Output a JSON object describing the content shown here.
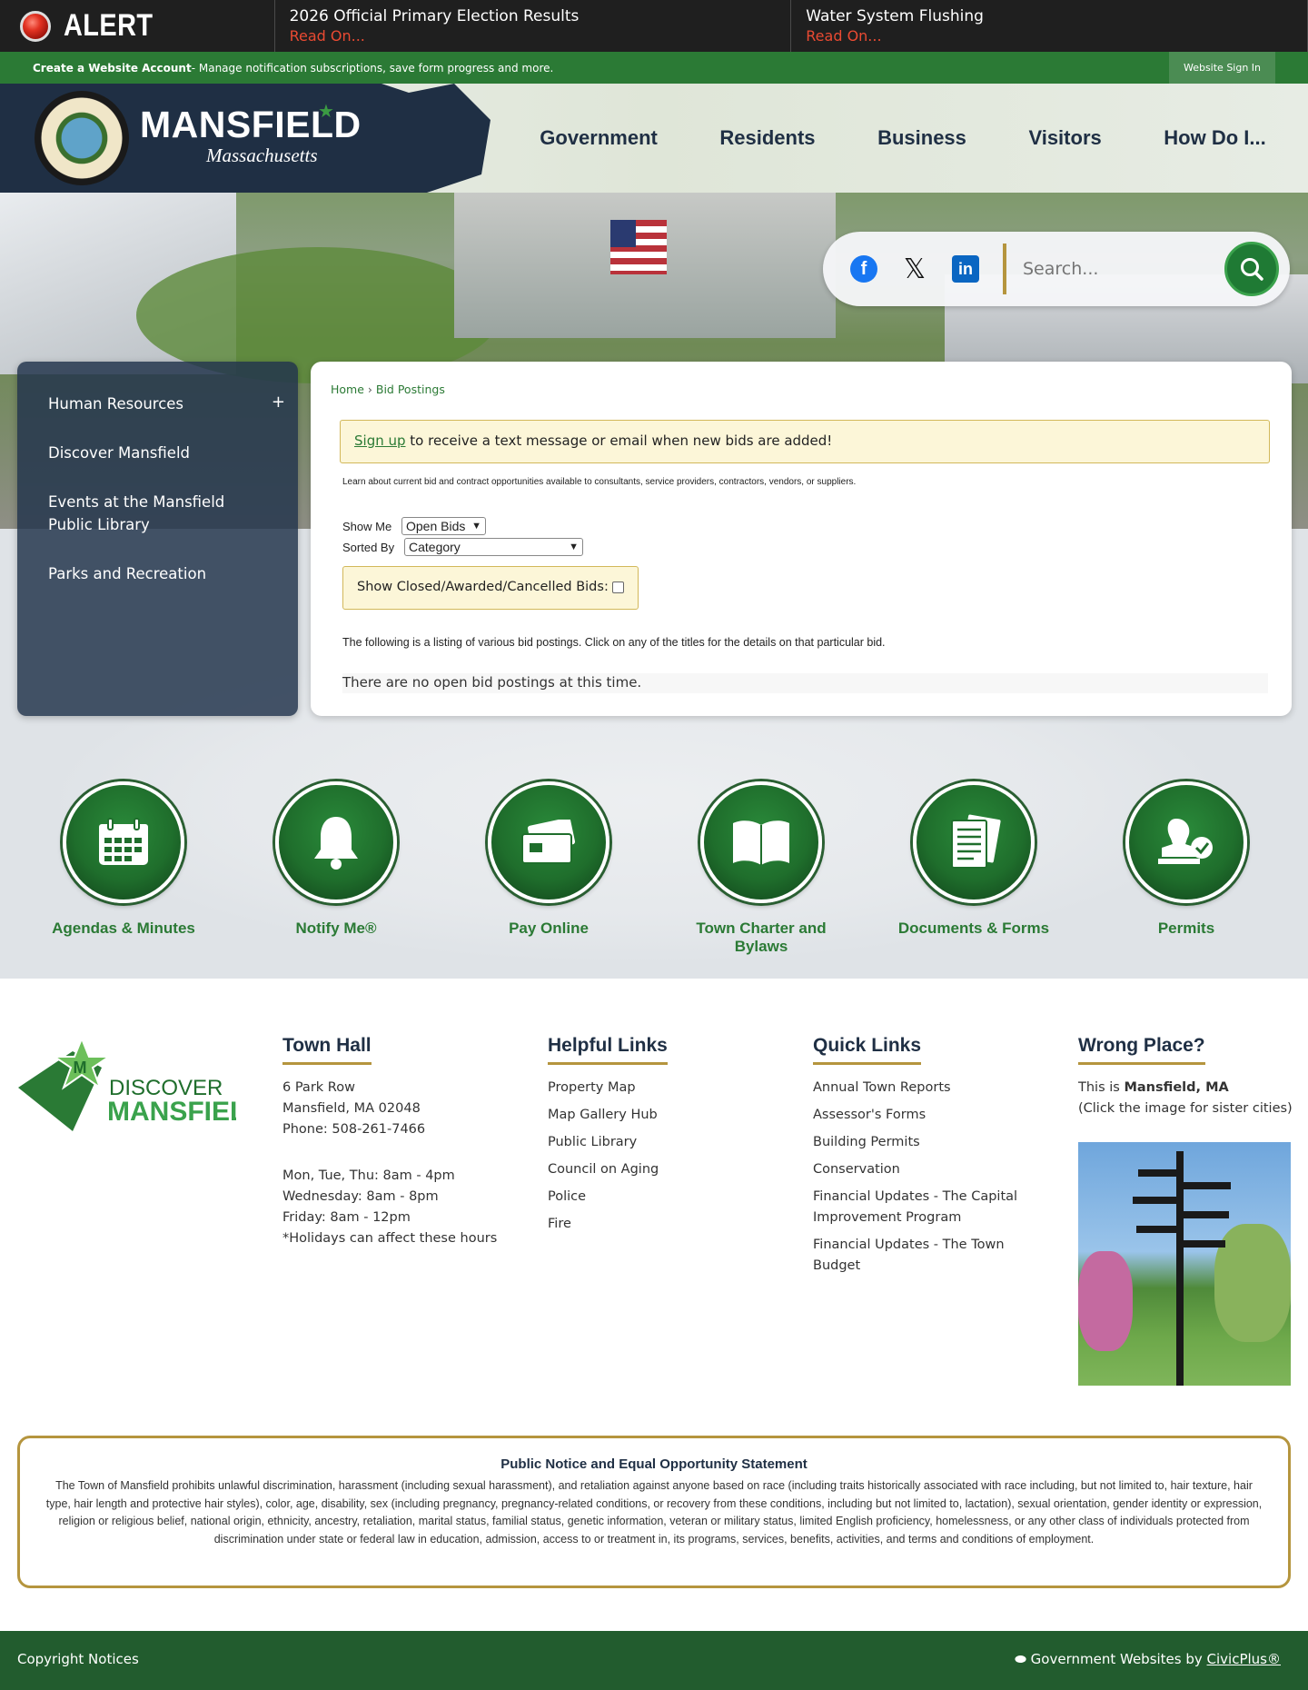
{
  "alert": {
    "label": "ALERT",
    "items": [
      {
        "title": "2026 Official Primary Election Results",
        "link": "Read On..."
      },
      {
        "title": "Water System Flushing",
        "link": "Read On..."
      }
    ]
  },
  "account_bar": {
    "create_label": "Create a Website Account",
    "create_desc": " - Manage notification subscriptions, save form progress and more.",
    "sign_in": "Website Sign In"
  },
  "header": {
    "town_name": "MANSFIELD",
    "state": "Massachusetts",
    "nav": [
      "Government",
      "Residents",
      "Business",
      "Visitors",
      "How Do I..."
    ]
  },
  "search": {
    "placeholder": "Search..."
  },
  "sidebar": {
    "items": [
      {
        "label": "Human Resources",
        "expand": "+"
      },
      {
        "label": "Discover Mansfield"
      },
      {
        "label": "Events at the Mansfield Public Library"
      },
      {
        "label": "Parks and Recreation"
      }
    ]
  },
  "breadcrumb": {
    "home": "Home",
    "sep": " › ",
    "current": "Bid Postings"
  },
  "bids": {
    "signup_link": "Sign up",
    "signup_text": " to receive a text message or email when new bids are added!",
    "learn_text": "Learn about current bid and contract opportunities available to consultants, service providers, contractors, vendors, or suppliers.",
    "show_me_label": "Show Me",
    "show_me_value": "Open Bids",
    "sorted_by_label": "Sorted By",
    "sorted_by_value": "Category",
    "closed_label": "Show Closed/Awarded/Cancelled Bids:",
    "listing_text": "The following is a listing of various bid postings. Click on any of the titles for the details on that particular bid.",
    "no_bids": "There are no open bid postings at this time."
  },
  "quick_links": [
    {
      "label": "Agendas & Minutes",
      "icon": "calendar-icon"
    },
    {
      "label": "Notify Me®",
      "icon": "bell-icon"
    },
    {
      "label": "Pay Online",
      "icon": "credit-card-icon"
    },
    {
      "label": "Town Charter and Bylaws",
      "icon": "book-icon"
    },
    {
      "label": "Documents & Forms",
      "icon": "documents-icon"
    },
    {
      "label": "Permits",
      "icon": "permit-stamp-icon"
    }
  ],
  "footer": {
    "discover_logo": {
      "line1": "DISCOVER",
      "line2": "MANSFIELD"
    },
    "town_hall": {
      "title": "Town Hall",
      "address": [
        "6 Park Row",
        "Mansfield, MA 02048",
        "Phone: 508-261-7466"
      ],
      "hours": [
        "Mon, Tue, Thu: 8am - 4pm",
        "Wednesday: 8am - 8pm",
        "Friday: 8am - 12pm",
        "*Holidays can affect these hours"
      ]
    },
    "helpful_links": {
      "title": "Helpful Links",
      "items": [
        "Property Map",
        "Map Gallery Hub",
        "Public Library",
        "Council on Aging",
        "Police",
        "Fire"
      ]
    },
    "quick_links": {
      "title": "Quick Links",
      "items": [
        "Annual Town Reports",
        "Assessor's Forms",
        "Building Permits",
        "Conservation",
        "Financial Updates - The Capital Improvement Program",
        "Financial Updates - The Town Budget"
      ]
    },
    "wrong_place": {
      "title": "Wrong Place?",
      "prefix": "This is ",
      "town": "Mansfield, MA",
      "note": "(Click the image for sister cities)"
    },
    "notice": {
      "title": "Public Notice and Equal Opportunity Statement",
      "text": "The Town of Mansfield prohibits unlawful discrimination, harassment (including sexual harassment), and retaliation against anyone based on race (including traits historically associated with race including, but not limited to, hair texture, hair type, hair length and protective hair styles), color, age, disability, sex (including pregnancy, pregnancy-related conditions, or recovery from these conditions, including but not limited to, lactation), sexual orientation, gender identity or expression, religion or religious belief, national origin, ethnicity, ancestry, retaliation, marital status, familial status, genetic information, veteran or military status, limited English proficiency, homelessness, or any other class of individuals protected from discrimination under state or federal law in education, admission, access to or treatment in, its programs, services, benefits, activities, and terms and conditions of employment."
    },
    "copyright": "Copyright Notices",
    "gov_prefix": "Government Websites by ",
    "gov_link": "CivicPlus®"
  },
  "colors": {
    "brand_green": "#2b7a35",
    "navy": "#1f2f44",
    "gold": "#b5953e",
    "alert_red": "#ea4a32"
  }
}
